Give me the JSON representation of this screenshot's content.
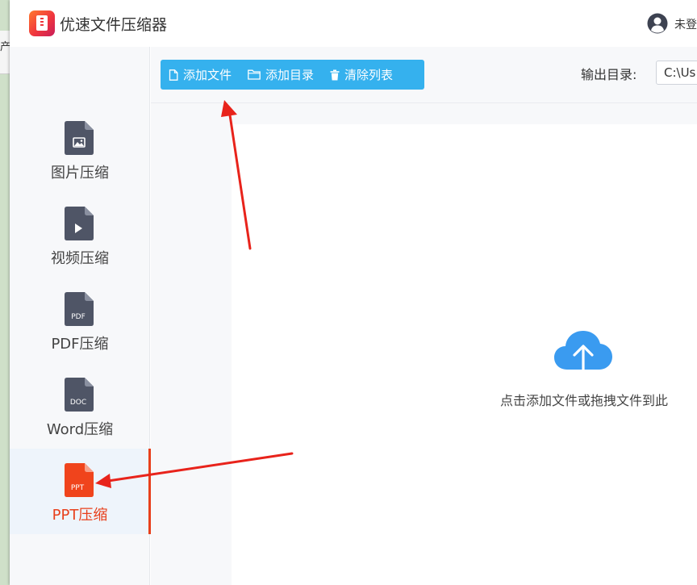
{
  "background_window": {
    "visible_char": "产"
  },
  "app": {
    "title": "优速文件压缩器",
    "user_label": "未登"
  },
  "sidebar": {
    "items": [
      {
        "label": "图片压缩",
        "icon": "image-file-icon",
        "glyph": "image",
        "active": false
      },
      {
        "label": "视频压缩",
        "icon": "video-file-icon",
        "glyph": "play",
        "active": false
      },
      {
        "label": "PDF压缩",
        "icon": "pdf-file-icon",
        "glyph": "PDF",
        "active": false
      },
      {
        "label": "Word压缩",
        "icon": "doc-file-icon",
        "glyph": "DOC",
        "active": false
      },
      {
        "label": "PPT压缩",
        "icon": "ppt-file-icon",
        "glyph": "PPT",
        "active": true
      }
    ]
  },
  "toolbar": {
    "add_file": "添加文件",
    "add_folder": "添加目录",
    "clear_list": "清除列表",
    "output_label": "输出目录:",
    "output_value": "C:\\Us"
  },
  "dropzone": {
    "text": "点击添加文件或拖拽文件到此"
  },
  "colors": {
    "accent": "#35b1ee",
    "active": "#e8401c",
    "icon_dark": "#4f5566",
    "icon_ppt": "#f0441c",
    "cloud": "#3a9bf0",
    "annotation_arrow": "#e8231b"
  }
}
